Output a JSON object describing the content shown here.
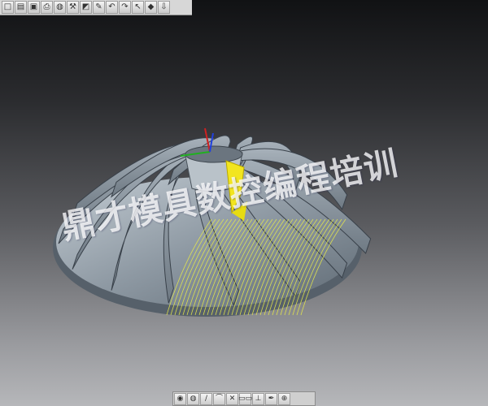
{
  "watermark": {
    "text": "鼎才模具数控编程培训"
  },
  "colors": {
    "blade": "#8f9aa4",
    "toolpath": "#e6e84a",
    "tool": "#f2e51f",
    "axis_x": "#20b020",
    "axis_y": "#d02020",
    "axis_z": "#2040e0"
  },
  "top_toolbar": {
    "icons": [
      "new-file-icon",
      "open-folder-icon",
      "save-icon",
      "print-icon",
      "globe-icon",
      "wrench-icon",
      "cube-icon",
      "pencil-icon",
      "undo-icon",
      "redo-icon",
      "select-arrow-icon",
      "render-icon",
      "info-icon"
    ],
    "glyphs": [
      "□",
      "▤",
      "▣",
      "⎙",
      "◍",
      "⚒",
      "◩",
      "✎",
      "↶",
      "↷",
      "↖",
      "◆",
      "⇩"
    ]
  },
  "bottom_toolbar": {
    "icons": [
      "shade-icon",
      "sphere-icon",
      "line-tool-icon",
      "arc-tool-icon",
      "cross-tool-icon",
      "measure-icon",
      "probe-icon",
      "brush-icon",
      "zoom-icon"
    ],
    "glyphs": [
      "◉",
      "◍",
      "∕",
      "⌒",
      "✕",
      "▭▭",
      "⊥",
      "✒",
      "⊕"
    ]
  }
}
